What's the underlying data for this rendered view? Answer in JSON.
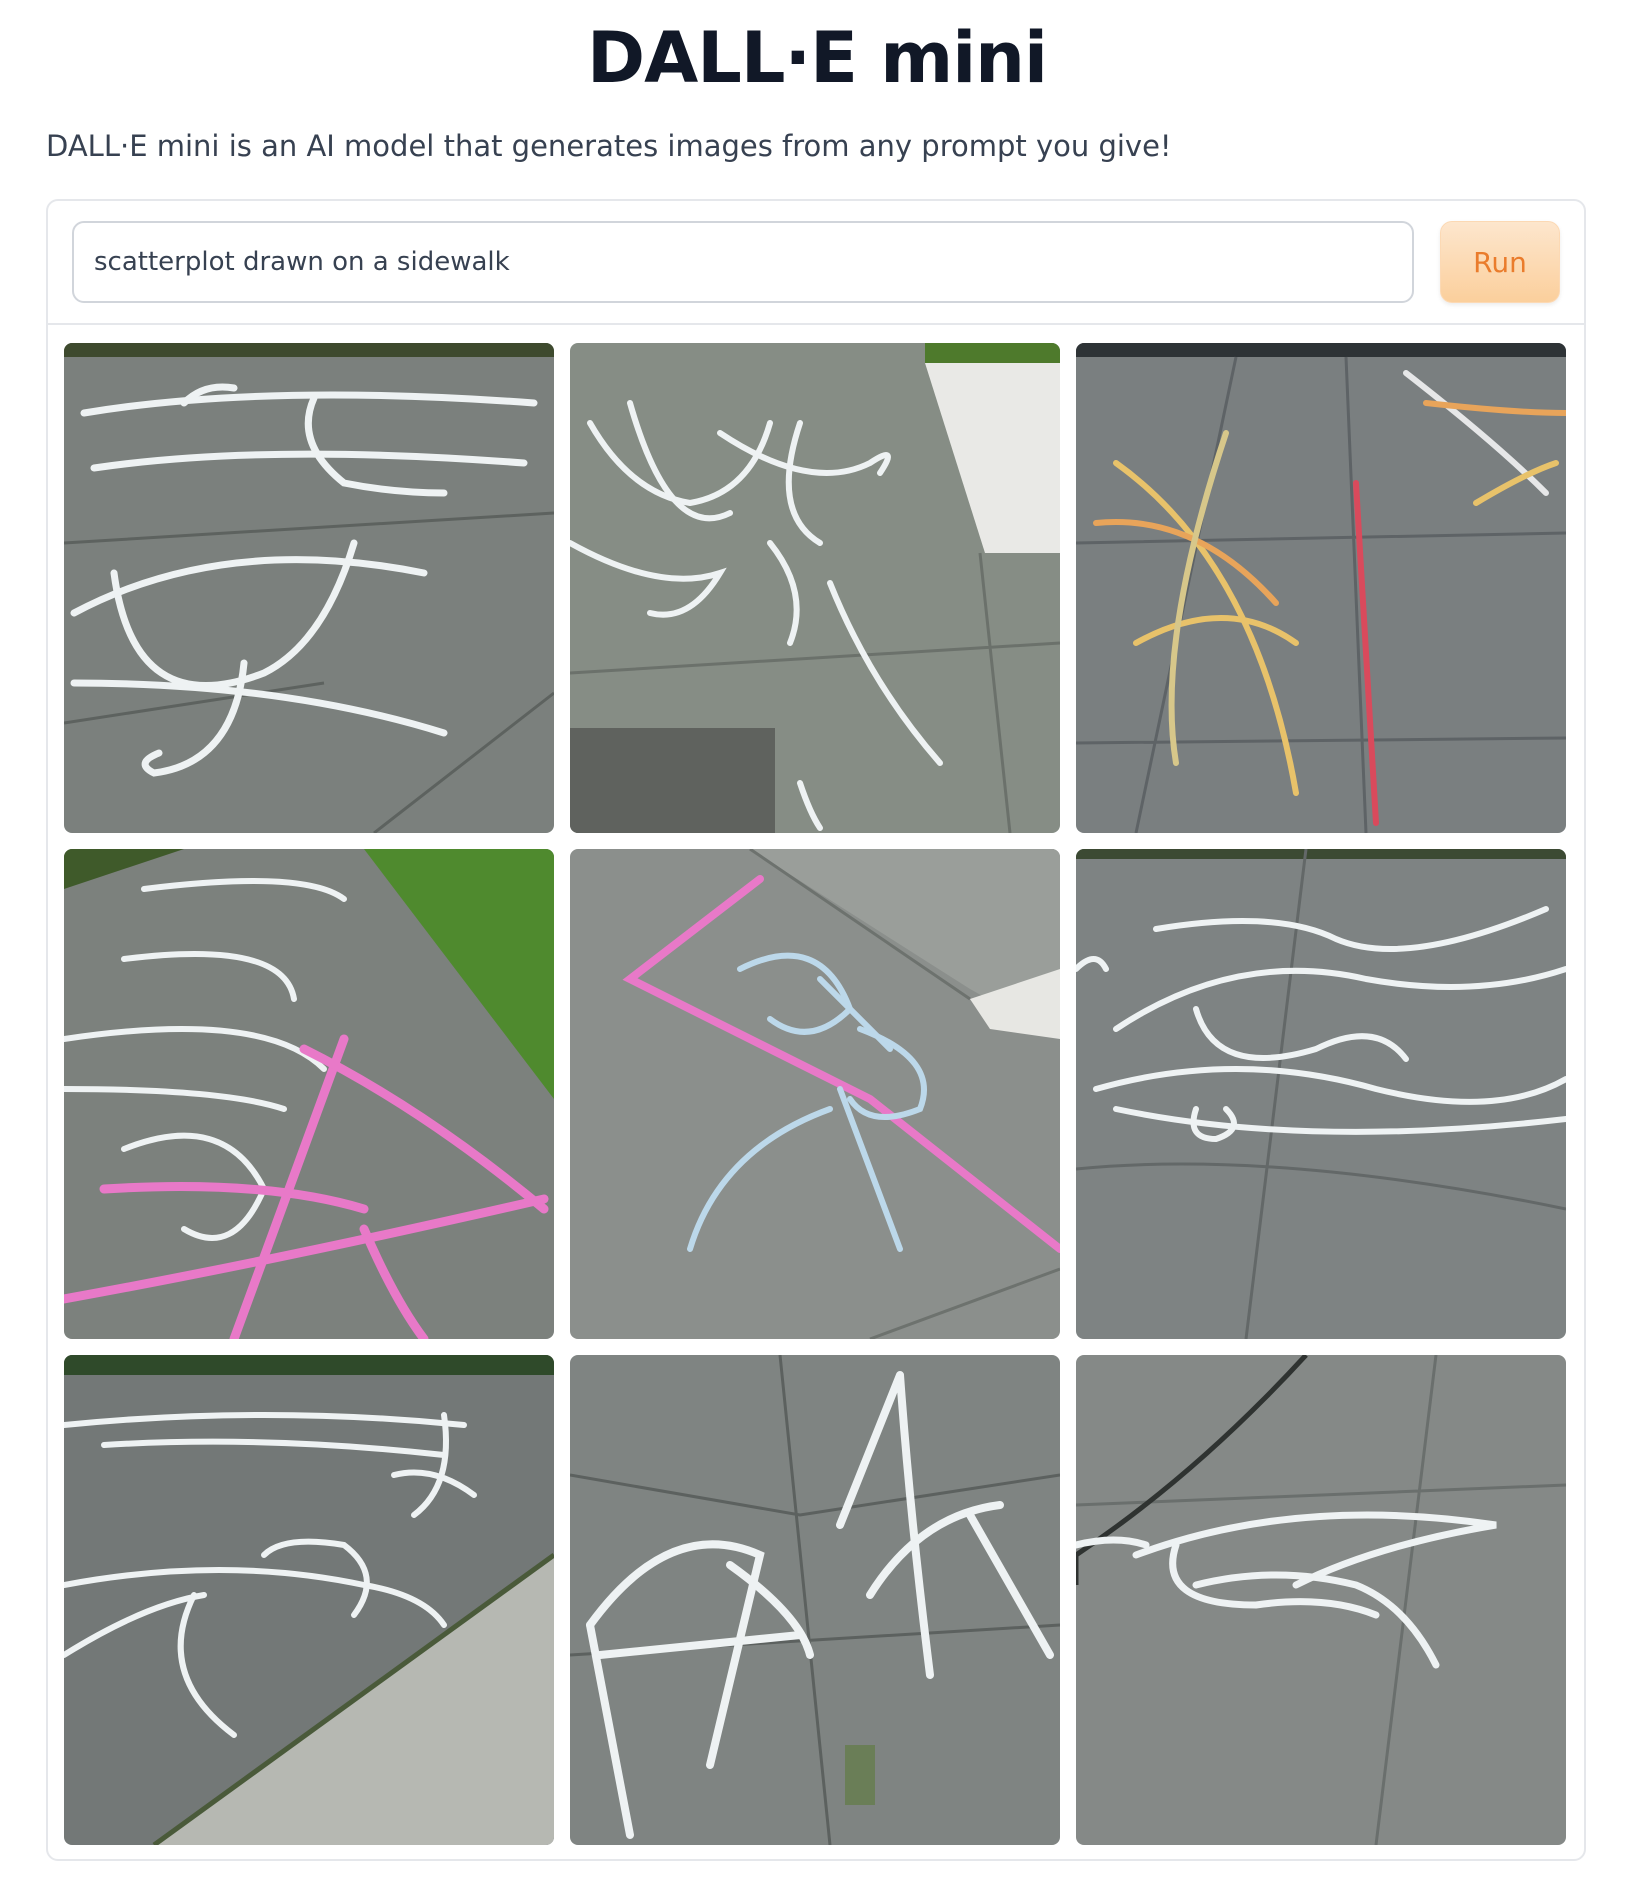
{
  "app": {
    "title": "DALL·E mini",
    "description": "DALL·E mini is an AI model that generates images from any prompt you give!"
  },
  "prompt_input": {
    "value": "scatterplot drawn on a sidewalk"
  },
  "run_button": {
    "label": "Run"
  },
  "colors": {
    "accent_text": "#ea7c2c",
    "button_gradient_top": "#fde6cd",
    "button_gradient_bottom": "#fbcf9c",
    "chalk_white": "#eef2f3",
    "chalk_pink": "#e879c8",
    "chalk_yellow": "#e8c26a",
    "chalk_red": "#d94a5c",
    "asphalt": "#767b78",
    "grass": "#4f8a2e"
  },
  "gallery": {
    "images": [
      {
        "subject": "white chalk curves on sidewalk"
      },
      {
        "subject": "white chalk lines near curb"
      },
      {
        "subject": "multicolor chalk lines on pavement"
      },
      {
        "subject": "pink and white chalk next to grass"
      },
      {
        "subject": "pink and light blue chalk on asphalt"
      },
      {
        "subject": "white chalk loops on pavement"
      },
      {
        "subject": "white chalk marks on road edge"
      },
      {
        "subject": "white chalk triangles on cracked pavement"
      },
      {
        "subject": "white chalk shape near crack"
      }
    ]
  }
}
